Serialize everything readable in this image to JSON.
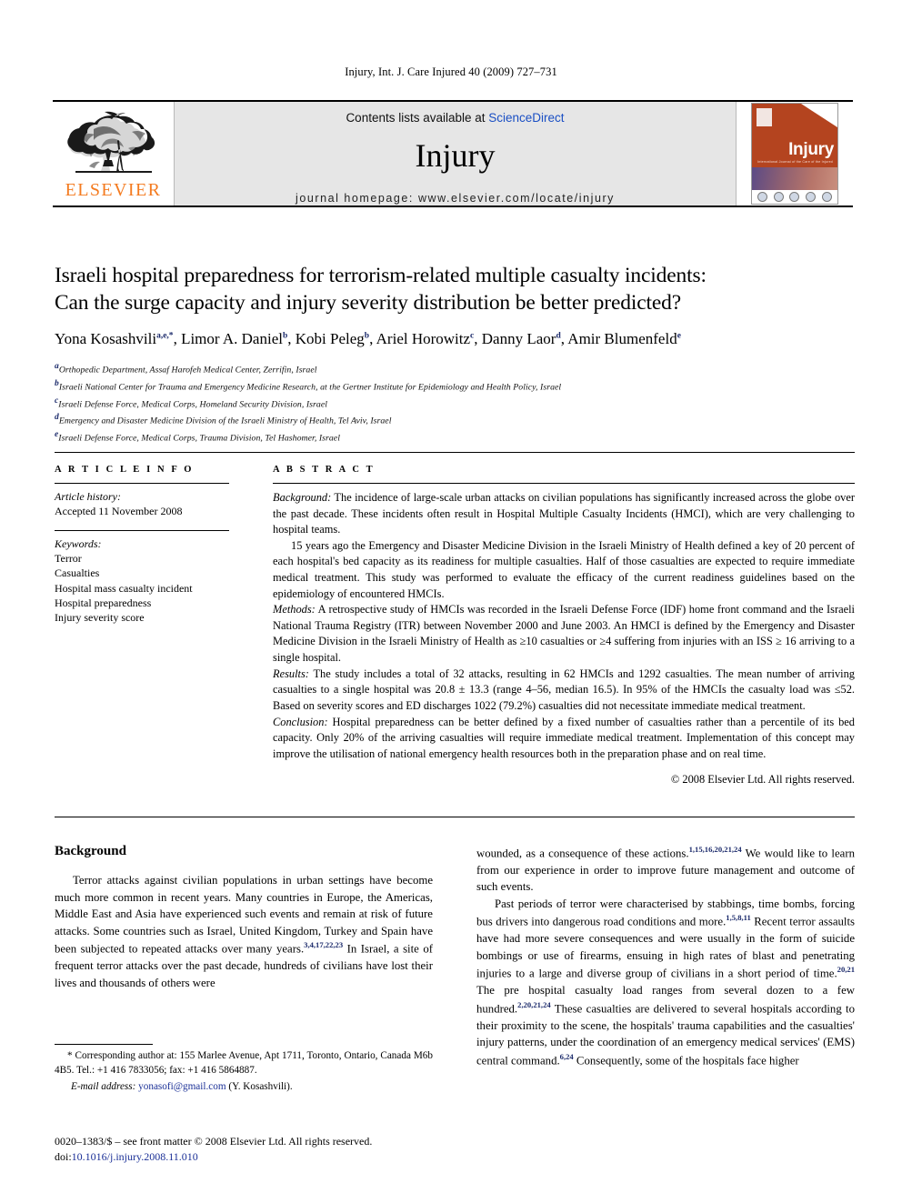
{
  "running_head": "Injury, Int. J. Care Injured 40 (2009) 727–731",
  "masthead": {
    "publisher_name": "ELSEVIER",
    "contents_prefix": "Contents lists available at ",
    "contents_link": "ScienceDirect",
    "journal_name": "Injury",
    "homepage": "journal homepage: www.elsevier.com/locate/injury",
    "cover": {
      "title": "Injury",
      "subtitle": "International Journal of the Care of the Injured"
    }
  },
  "article": {
    "title_line1": "Israeli hospital preparedness for terrorism-related multiple casualty incidents:",
    "title_line2": "Can the surge capacity and injury severity distribution be better predicted?",
    "authors": [
      {
        "name": "Yona Kosashvili",
        "marks": "a,e,*"
      },
      {
        "name": "Limor A. Daniel",
        "marks": "b"
      },
      {
        "name": "Kobi Peleg",
        "marks": "b"
      },
      {
        "name": "Ariel Horowitz",
        "marks": "c"
      },
      {
        "name": "Danny Laor",
        "marks": "d"
      },
      {
        "name": "Amir Blumenfeld",
        "marks": "e"
      }
    ],
    "affiliations": [
      {
        "mark": "a",
        "text": "Orthopedic Department, Assaf Harofeh Medical Center, Zerrifin, Israel"
      },
      {
        "mark": "b",
        "text": "Israeli National Center for Trauma and Emergency Medicine Research, at the Gertner Institute for Epidemiology and Health Policy, Israel"
      },
      {
        "mark": "c",
        "text": "Israeli Defense Force, Medical Corps, Homeland Security Division, Israel"
      },
      {
        "mark": "d",
        "text": "Emergency and Disaster Medicine Division of the Israeli Ministry of Health, Tel Aviv, Israel"
      },
      {
        "mark": "e",
        "text": "Israeli Defense Force, Medical Corps, Trauma Division, Tel Hashomer, Israel"
      }
    ]
  },
  "article_info": {
    "heading": "A R T I C L E   I N F O",
    "history_label": "Article history:",
    "history_value": "Accepted 11 November 2008",
    "keywords_label": "Keywords:",
    "keywords": [
      "Terror",
      "Casualties",
      "Hospital mass casualty incident",
      "Hospital preparedness",
      "Injury severity score"
    ]
  },
  "abstract": {
    "heading": "A B S T R A C T",
    "background_label": "Background:",
    "background_text": " The incidence of large-scale urban attacks on civilian populations has significantly increased across the globe over the past decade. These incidents often result in Hospital Multiple Casualty Incidents (HMCI), which are very challenging to hospital teams.",
    "background_p2": "15 years ago the Emergency and Disaster Medicine Division in the Israeli Ministry of Health defined a key of 20 percent of each hospital's bed capacity as its readiness for multiple casualties. Half of those casualties are expected to require immediate medical treatment. This study was performed to evaluate the efficacy of the current readiness guidelines based on the epidemiology of encountered HMCIs.",
    "methods_label": "Methods:",
    "methods_text": " A retrospective study of HMCIs was recorded in the Israeli Defense Force (IDF) home front command and the Israeli National Trauma Registry (ITR) between November 2000 and June 2003. An HMCI is defined by the Emergency and Disaster Medicine Division in the Israeli Ministry of Health as ≥10 casualties or ≥4 suffering from injuries with an ISS ≥ 16 arriving to a single hospital.",
    "results_label": "Results:",
    "results_text": " The study includes a total of 32 attacks, resulting in 62 HMCIs and 1292 casualties. The mean number of arriving casualties to a single hospital was 20.8 ± 13.3 (range 4–56, median 16.5). In 95% of the HMCIs the casualty load was ≤52. Based on severity scores and ED discharges 1022 (79.2%) casualties did not necessitate immediate medical treatment.",
    "conclusion_label": "Conclusion:",
    "conclusion_text": " Hospital preparedness can be better defined by a fixed number of casualties rather than a percentile of its bed capacity. Only 20% of the arriving casualties will require immediate medical treatment. Implementation of this concept may improve the utilisation of national emergency health resources both in the preparation phase and on real time.",
    "copyright": "© 2008 Elsevier Ltd. All rights reserved."
  },
  "body": {
    "section_heading": "Background",
    "left_p1": "Terror attacks against civilian populations in urban settings have become much more common in recent years. Many countries in Europe, the Americas, Middle East and Asia have experienced such events and remain at risk of future attacks. Some countries such as Israel, United Kingdom, Turkey and Spain have been subjected to repeated attacks over many years.",
    "left_p1_ref": "3,4,17,22,23",
    "left_p1_cont": " In Israel, a site of frequent terror attacks over the past decade, hundreds of civilians have lost their lives and thousands of others were",
    "right_p1_start": "wounded, as a consequence of these actions.",
    "right_p1_ref": "1,15,16,20,21,24",
    "right_p1_cont": " We would like to learn from our experience in order to improve future management and outcome of such events.",
    "right_p2_a": "Past periods of terror were characterised by stabbings, time bombs, forcing bus drivers into dangerous road conditions and more.",
    "right_p2_ref1": "1,5,8,11",
    "right_p2_b": " Recent terror assaults have had more severe consequences and were usually in the form of suicide bombings or use of firearms, ensuing in high rates of blast and penetrating injuries to a large and diverse group of civilians in a short period of time.",
    "right_p2_ref2": "20,21",
    "right_p2_c": " The pre hospital casualty load ranges from several dozen to a few hundred.",
    "right_p2_ref3": "2,20,21,24",
    "right_p2_d": " These casualties are delivered to several hospitals according to their proximity to the scene, the hospitals' trauma capabilities and the casualties' injury patterns, under the coordination of an emergency medical services' (EMS) central command.",
    "right_p2_ref4": "6,24",
    "right_p2_e": " Consequently, some of the hospitals face higher"
  },
  "footnotes": {
    "corresponding": "* Corresponding author at: 155 Marlee Avenue, Apt 1711, Toronto, Ontario, Canada M6b 4B5. Tel.: +1 416 7833056; fax: +1 416 5864887.",
    "email_label": "E-mail address:",
    "email_value": "yonasofi@gmail.com",
    "email_attrib": " (Y. Kosashvili).",
    "issn_line": "0020–1383/$ – see front matter © 2008 Elsevier Ltd. All rights reserved.",
    "doi_label": "doi:",
    "doi_value": "10.1016/j.injury.2008.11.010"
  },
  "colors": {
    "elsevier_orange": "#F47B20",
    "link_blue": "#1a4fc4",
    "ref_blue": "#1b2a6b",
    "masthead_grey": "#e6e6e6",
    "cover_red": "#b4441f"
  }
}
